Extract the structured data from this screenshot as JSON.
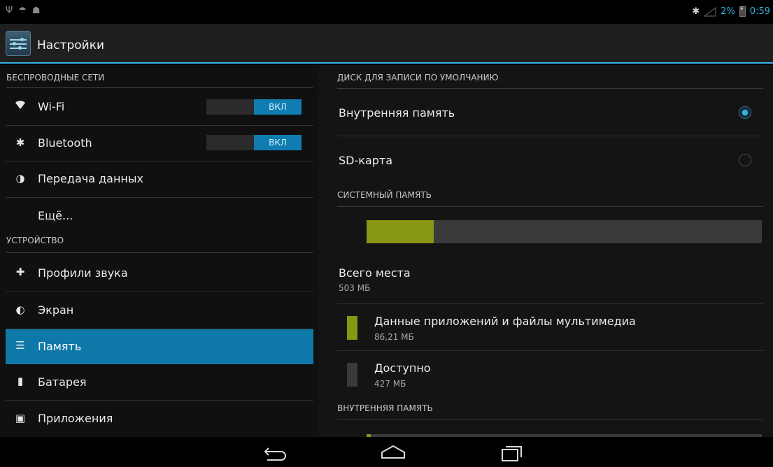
{
  "status_bar": {
    "battery": "2%",
    "time": "0:59"
  },
  "app": {
    "title": "Настройки"
  },
  "sidebar": {
    "sections": [
      {
        "label": "БЕСПРОВОДНЫЕ СЕТИ"
      },
      {
        "label": "УСТРОЙСТВО"
      }
    ],
    "items": [
      {
        "label": "Wi-Fi",
        "toggle": "ВКЛ"
      },
      {
        "label": "Bluetooth",
        "toggle": "ВКЛ"
      },
      {
        "label": "Передача данных"
      },
      {
        "label": "Ещё..."
      },
      {
        "label": "Профили звука"
      },
      {
        "label": "Экран"
      },
      {
        "label": "Память",
        "active": true
      },
      {
        "label": "Батарея"
      },
      {
        "label": "Приложения"
      }
    ]
  },
  "storage": {
    "default_disk_header": "ДИСК ДЛЯ ЗАПИСИ ПО УМОЛЧАНИЮ",
    "options": [
      {
        "label": "Внутренняя память",
        "selected": true
      },
      {
        "label": "SD-карта",
        "selected": false
      }
    ],
    "system_header": "СИСТЕМНЫЙ ПАМЯТЬ",
    "usage_fraction": 0.17,
    "total_label": "Всего места",
    "total_value": "503 МБ",
    "entries": [
      {
        "label": "Данные приложений и файлы мультимедиа",
        "value": "86,21 МБ",
        "color": "#889814"
      },
      {
        "label": "Доступно",
        "value": "427 МБ",
        "color": "#3a3a3a"
      }
    ],
    "internal_header": "ВНУТРЕННЯЯ ПАМЯТЬ"
  },
  "colors": {
    "accent": "#33b5e5",
    "active_item": "#0e79a8",
    "used": "#889814"
  }
}
